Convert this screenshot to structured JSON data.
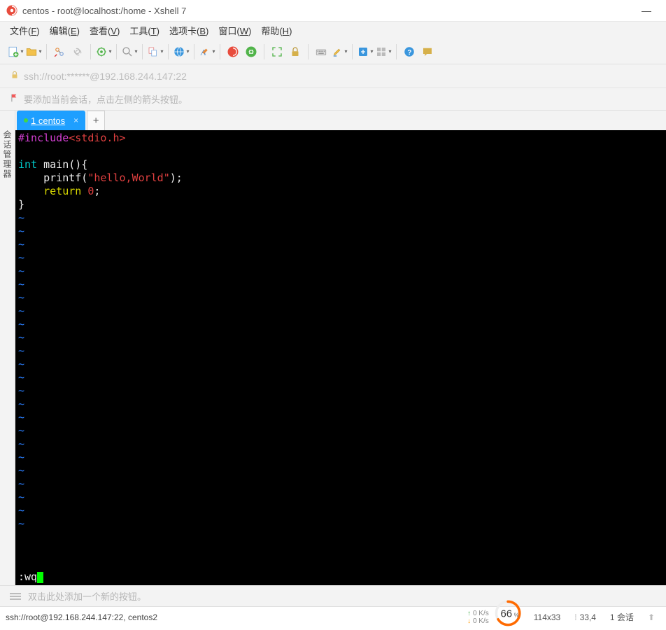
{
  "window": {
    "title": "centos - root@localhost:/home - Xshell 7"
  },
  "menus": [
    {
      "label": "文件",
      "key": "F"
    },
    {
      "label": "编辑",
      "key": "E"
    },
    {
      "label": "查看",
      "key": "V"
    },
    {
      "label": "工具",
      "key": "T"
    },
    {
      "label": "选项卡",
      "key": "B"
    },
    {
      "label": "窗口",
      "key": "W"
    },
    {
      "label": "帮助",
      "key": "H"
    }
  ],
  "addressbar": {
    "url": "ssh://root:******@192.168.244.147:22"
  },
  "hintbar": {
    "text": "要添加当前会话，点击左侧的箭头按钮。"
  },
  "sidetab": {
    "label": "会话管理器"
  },
  "tabs": {
    "active": {
      "name": "1 centos"
    }
  },
  "code": {
    "l1_a": "#include",
    "l1_b": "<stdio.h>",
    "l2_a": "int",
    "l2_b": " main(){",
    "l3_a": "    printf(",
    "l3_b": "\"hello,World\"",
    "l3_c": ");",
    "l4_a": "    ",
    "l4_b": "return",
    "l4_c": " 0",
    "l4_d": ";",
    "l5": "}",
    "tilde": "~",
    "cmd": ":wq"
  },
  "quickbar": {
    "text": "双击此处添加一个新的按钮。"
  },
  "status": {
    "left": "ssh://root@192.168.244.147:22, centos2",
    "net_up": "0  K/s",
    "net_dn": "0  K/s",
    "gauge": "66",
    "gauge_pct": "%",
    "term_size": "114x33",
    "cursor_pos": "33,4",
    "sessions": "1 会话"
  }
}
